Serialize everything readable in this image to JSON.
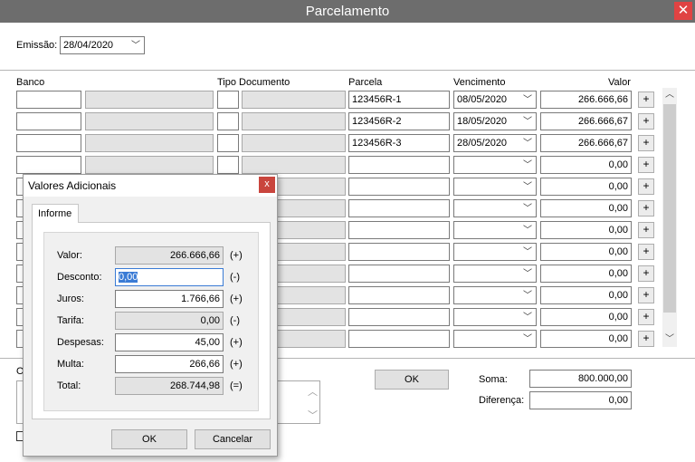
{
  "window": {
    "title": "Parcelamento",
    "close_glyph": "✕"
  },
  "header": {
    "emissao_label": "Emissão:",
    "emissao_value": "28/04/2020"
  },
  "columns": {
    "banco": "Banco",
    "tipo_documento": "Tipo Documento",
    "parcela": "Parcela",
    "vencimento": "Vencimento",
    "valor": "Valor"
  },
  "rows": [
    {
      "parcela": "123456R-1",
      "vencimento": "08/05/2020",
      "valor": "266.666,66"
    },
    {
      "parcela": "123456R-2",
      "vencimento": "18/05/2020",
      "valor": "266.666,67"
    },
    {
      "parcela": "123456R-3",
      "vencimento": "28/05/2020",
      "valor": "266.666,67"
    },
    {
      "parcela": "",
      "vencimento": "",
      "valor": "0,00"
    },
    {
      "parcela": "",
      "vencimento": "",
      "valor": "0,00"
    },
    {
      "parcela": "",
      "vencimento": "",
      "valor": "0,00"
    },
    {
      "parcela": "",
      "vencimento": "",
      "valor": "0,00"
    },
    {
      "parcela": "",
      "vencimento": "",
      "valor": "0,00"
    },
    {
      "parcela": "",
      "vencimento": "",
      "valor": "0,00"
    },
    {
      "parcela": "",
      "vencimento": "",
      "valor": "0,00"
    },
    {
      "parcela": "",
      "vencimento": "",
      "valor": "0,00"
    },
    {
      "parcela": "",
      "vencimento": "",
      "valor": "0,00"
    }
  ],
  "plus_glyph": "+",
  "footer": {
    "obs_label": "O",
    "ok_label": "OK",
    "soma_label": "Soma:",
    "soma_value": "800.000,00",
    "diferenca_label": "Diferença:",
    "diferenca_value": "0,00"
  },
  "dialog": {
    "title": "Valores Adicionais",
    "close_glyph": "x",
    "tab_label": "Informe",
    "fields": [
      {
        "label": "Valor:",
        "value": "266.666,66",
        "sign": "(+)",
        "readonly": true
      },
      {
        "label": "Desconto:",
        "value": "0,00",
        "sign": "(-)",
        "readonly": false
      },
      {
        "label": "Juros:",
        "value": "1.766,66",
        "sign": "(+)",
        "readonly": false
      },
      {
        "label": "Tarifa:",
        "value": "0,00",
        "sign": "(-)",
        "readonly": true
      },
      {
        "label": "Despesas:",
        "value": "45,00",
        "sign": "(+)",
        "readonly": false
      },
      {
        "label": "Multa:",
        "value": "266,66",
        "sign": "(+)",
        "readonly": false
      },
      {
        "label": "Total:",
        "value": "268.744,98",
        "sign": "(=)",
        "readonly": true
      }
    ],
    "ok_label": "OK",
    "cancel_label": "Cancelar"
  },
  "colors": {
    "titlebar": "#6d6d6d",
    "close": "#e04343",
    "selection": "#3a7bd5"
  }
}
